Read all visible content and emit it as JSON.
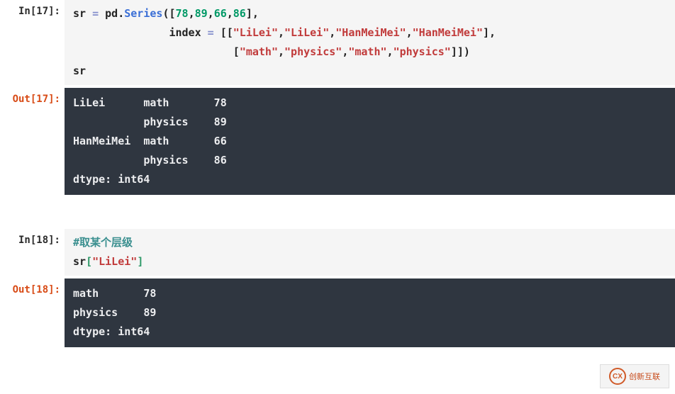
{
  "cells": [
    {
      "in_prompt": "In[17]:",
      "out_prompt": "Out[17]:",
      "input_lines": [
        [
          {
            "t": "sr ",
            "c": "tok-plain"
          },
          {
            "t": "=",
            "c": "tok-op"
          },
          {
            "t": " pd.",
            "c": "tok-plain"
          },
          {
            "t": "Series",
            "c": "tok-fn"
          },
          {
            "t": "([",
            "c": "tok-plain"
          },
          {
            "t": "78",
            "c": "tok-num"
          },
          {
            "t": ",",
            "c": "tok-plain"
          },
          {
            "t": "89",
            "c": "tok-num"
          },
          {
            "t": ",",
            "c": "tok-plain"
          },
          {
            "t": "66",
            "c": "tok-num"
          },
          {
            "t": ",",
            "c": "tok-plain"
          },
          {
            "t": "86",
            "c": "tok-num"
          },
          {
            "t": "],",
            "c": "tok-plain"
          }
        ],
        [
          {
            "t": "               index ",
            "c": "tok-plain"
          },
          {
            "t": "=",
            "c": "tok-op"
          },
          {
            "t": " [[",
            "c": "tok-plain"
          },
          {
            "t": "\"LiLei\"",
            "c": "tok-str"
          },
          {
            "t": ",",
            "c": "tok-plain"
          },
          {
            "t": "\"LiLei\"",
            "c": "tok-str"
          },
          {
            "t": ",",
            "c": "tok-plain"
          },
          {
            "t": "\"HanMeiMei\"",
            "c": "tok-str"
          },
          {
            "t": ",",
            "c": "tok-plain"
          },
          {
            "t": "\"HanMeiMei\"",
            "c": "tok-str"
          },
          {
            "t": "],",
            "c": "tok-plain"
          }
        ],
        [
          {
            "t": "                         [",
            "c": "tok-plain"
          },
          {
            "t": "\"math\"",
            "c": "tok-str"
          },
          {
            "t": ",",
            "c": "tok-plain"
          },
          {
            "t": "\"physics\"",
            "c": "tok-str"
          },
          {
            "t": ",",
            "c": "tok-plain"
          },
          {
            "t": "\"math\"",
            "c": "tok-str"
          },
          {
            "t": ",",
            "c": "tok-plain"
          },
          {
            "t": "\"physics\"",
            "c": "tok-str"
          },
          {
            "t": "]])",
            "c": "tok-plain"
          }
        ],
        [
          {
            "t": "sr",
            "c": "tok-plain"
          }
        ]
      ],
      "output_text": "LiLei      math       78\n           physics    89\nHanMeiMei  math       66\n           physics    86\ndtype: int64"
    },
    {
      "in_prompt": "In[18]:",
      "out_prompt": "Out[18]:",
      "input_lines": [
        [
          {
            "t": "#取某个层级",
            "c": "tok-comment"
          }
        ],
        [
          {
            "t": "sr",
            "c": "tok-plain"
          },
          {
            "t": "[",
            "c": "tok-bracket"
          },
          {
            "t": "\"LiLei\"",
            "c": "tok-str"
          },
          {
            "t": "]",
            "c": "tok-bracket"
          }
        ]
      ],
      "output_text": "math       78\nphysics    89\ndtype: int64"
    }
  ],
  "watermark": {
    "icon_text": "CX",
    "label": "创新互联"
  }
}
